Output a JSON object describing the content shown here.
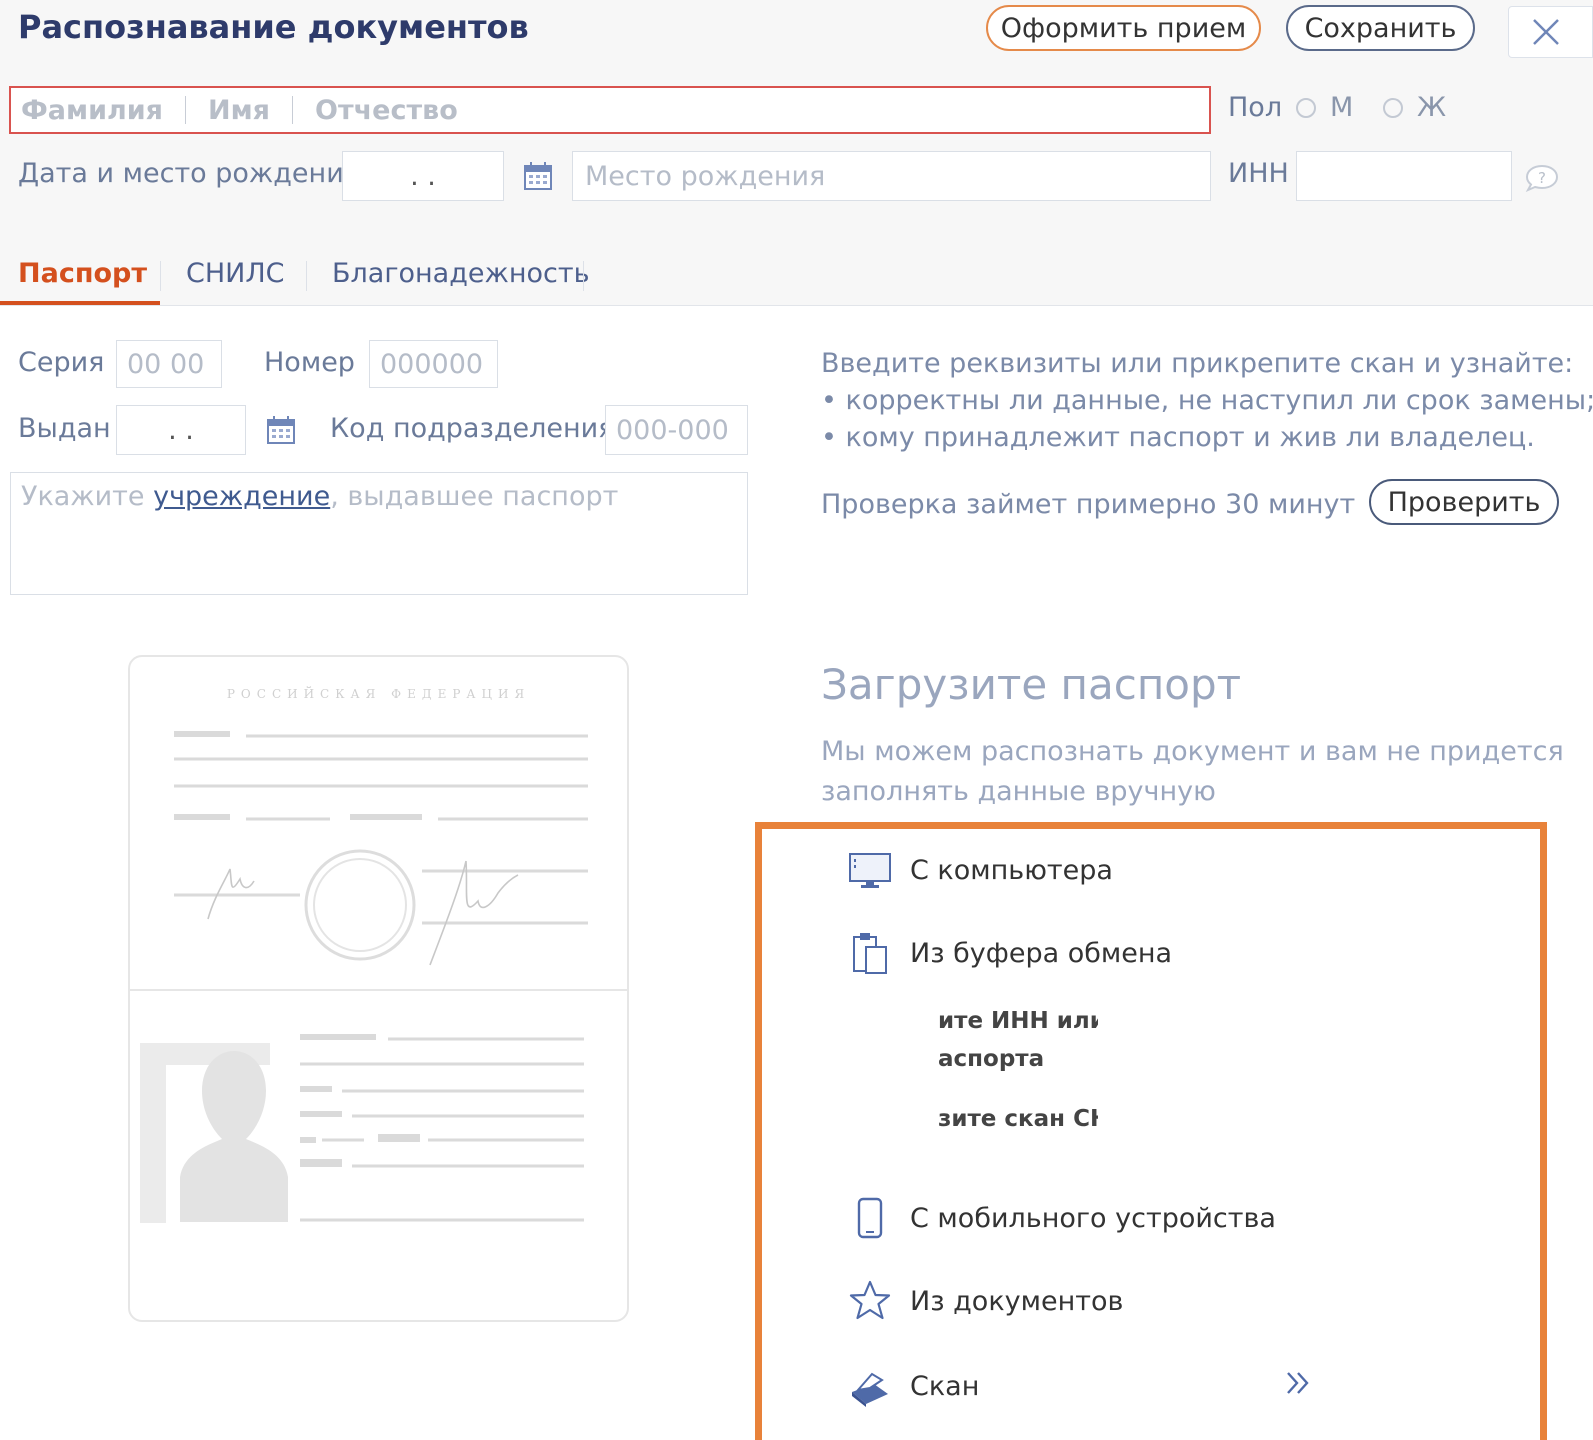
{
  "header": {
    "title": "Распознавание документов",
    "book_label": "Оформить прием",
    "save_label": "Сохранить",
    "accent_color": "#e58a4a"
  },
  "person": {
    "surname_placeholder": "Фамилия",
    "name_placeholder": "Имя",
    "patronymic_placeholder": "Отчество",
    "gender_label": "Пол",
    "gender_options": [
      "М",
      "Ж"
    ],
    "birth_label": "Дата и место рождения",
    "birth_date_mask": ".   .",
    "birth_place_placeholder": "Место рождения",
    "inn_label": "ИНН"
  },
  "tabs": [
    {
      "label": "Паспорт",
      "active": true
    },
    {
      "label": "СНИЛС",
      "active": false
    },
    {
      "label": "Благонадежность",
      "active": false
    }
  ],
  "passport": {
    "series_label": "Серия",
    "series_placeholder": "00 00",
    "number_label": "Номер",
    "number_placeholder": "000000",
    "issued_label": "Выдан",
    "issued_date_mask": ".   .",
    "dept_code_label": "Код подразделения",
    "dept_code_placeholder": "000-000",
    "authority_prefix": "Укажите ",
    "authority_link": "учреждение",
    "authority_suffix": ", выдавшее паспорт",
    "illustration_caption": "РОССИЙСКАЯ ФЕДЕРАЦИЯ"
  },
  "check": {
    "line1": "Введите реквизиты или прикрепите скан и узнайте:",
    "line2": "• корректны ли данные, не наступил ли срок замены;",
    "line3": "• кому принадлежит паспорт и жив ли владелец.",
    "duration": "Проверка займет примерно 30 минут",
    "check_label": "Проверить"
  },
  "upload": {
    "title": "Загрузите паспорт",
    "subtitle_line1": "Мы можем распознать документ и вам не придется",
    "subtitle_line2": "заполнять данные вручную",
    "highlight_color": "#e8823a",
    "options": [
      {
        "label": "С компьютера",
        "icon": "monitor-icon"
      },
      {
        "label": "Из буфера обмена",
        "icon": "clipboard-icon"
      },
      {
        "label": "С мобильного устройства",
        "icon": "phone-icon"
      },
      {
        "label": "Из документов",
        "icon": "star-icon"
      },
      {
        "label": "Скан",
        "icon": "scanner-icon"
      }
    ],
    "clipped_lines": [
      "ите ИНН или з",
      "аспорта",
      "зите скан СН"
    ]
  }
}
